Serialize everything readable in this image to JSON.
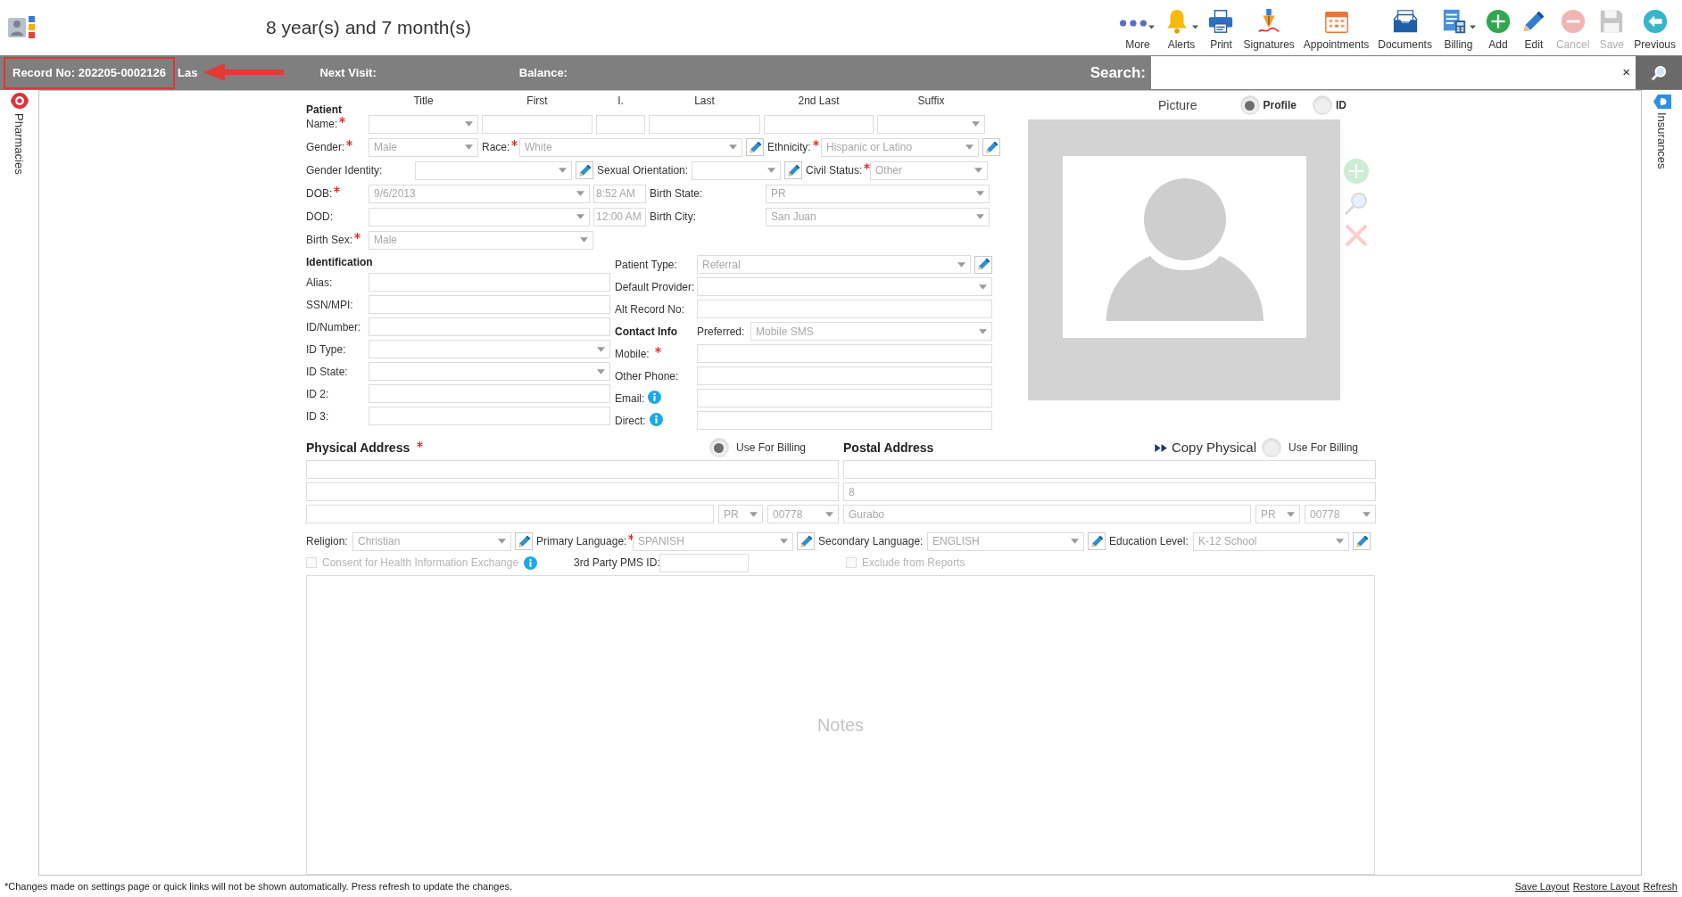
{
  "header": {
    "age": "8 year(s) and 7 month(s)"
  },
  "toolbar": [
    {
      "kind": "more",
      "label": "More",
      "dropdown": true,
      "disabled": false
    },
    {
      "kind": "alerts",
      "label": "Alerts",
      "dropdown": true,
      "disabled": false
    },
    {
      "kind": "print",
      "label": "Print",
      "dropdown": false,
      "disabled": false
    },
    {
      "kind": "signatures",
      "label": "Signatures",
      "dropdown": false,
      "disabled": false
    },
    {
      "kind": "appointments",
      "label": "Appointments",
      "dropdown": false,
      "disabled": false
    },
    {
      "kind": "documents",
      "label": "Documents",
      "dropdown": false,
      "disabled": false
    },
    {
      "kind": "billing",
      "label": "Billing",
      "dropdown": true,
      "disabled": false
    },
    {
      "kind": "add",
      "label": "Add",
      "dropdown": false,
      "disabled": false
    },
    {
      "kind": "edit",
      "label": "Edit",
      "dropdown": false,
      "disabled": false
    },
    {
      "kind": "cancel",
      "label": "Cancel",
      "dropdown": false,
      "disabled": true
    },
    {
      "kind": "save",
      "label": "Save",
      "dropdown": false,
      "disabled": true
    },
    {
      "kind": "previous",
      "label": "Previous",
      "dropdown": false,
      "disabled": false
    }
  ],
  "info_bar": {
    "record_no": "Record No: 202205-0002126",
    "cut_label": "Las",
    "next_visit": "Next Visit:",
    "balance": "Balance:"
  },
  "search": {
    "label": "Search:",
    "clear": "×"
  },
  "side_tabs": {
    "left": "Pharmacies",
    "right": "Insurances"
  },
  "patient": {
    "heading": "Patient",
    "columns": [
      "Title",
      "First",
      "I.",
      "Last",
      "2nd Last",
      "Suffix"
    ],
    "name": {
      "label": "Name:",
      "required": true
    },
    "gender": {
      "label": "Gender:",
      "required": true,
      "value": "Male"
    },
    "race": {
      "label": "Race:",
      "required": true,
      "value": "White",
      "editable": true
    },
    "ethnicity": {
      "label": "Ethnicity:",
      "required": true,
      "value": "Hispanic or Latino",
      "editable": true
    },
    "gender_identity": {
      "label": "Gender Identity:",
      "editable": true
    },
    "sexual_orientation": {
      "label": "Sexual Orientation:",
      "editable": true
    },
    "civil_status": {
      "label": "Civil Status:",
      "required": true,
      "value": "Other"
    },
    "dob": {
      "label": "DOB:",
      "required": true,
      "value": "9/6/2013",
      "time": "8:52 AM"
    },
    "birth_state": {
      "label": "Birth State:",
      "value": "PR"
    },
    "dod": {
      "label": "DOD:",
      "time": "12:00 AM"
    },
    "birth_city": {
      "label": "Birth City:",
      "value": "San Juan"
    },
    "birth_sex": {
      "label": "Birth Sex:",
      "required": true,
      "value": "Male"
    }
  },
  "identification": {
    "heading": "Identification",
    "fields": [
      {
        "label": "Alias:",
        "kind": "text"
      },
      {
        "label": "SSN/MPI:",
        "kind": "text"
      },
      {
        "label": "ID/Number:",
        "kind": "text"
      },
      {
        "label": "ID Type:",
        "kind": "select"
      },
      {
        "label": "ID State:",
        "kind": "select"
      },
      {
        "label": "ID 2:",
        "kind": "text"
      },
      {
        "label": "ID 3:",
        "kind": "text"
      }
    ]
  },
  "details": [
    {
      "label": "Patient Type:",
      "kind": "select",
      "value": "Referral",
      "editable": true
    },
    {
      "label": "Default Provider:",
      "kind": "select"
    },
    {
      "label": "Alt Record No:",
      "kind": "text"
    }
  ],
  "contact": {
    "heading": "Contact Info",
    "preferred": {
      "label": "Preferred:",
      "value": "Mobile SMS"
    },
    "fields": [
      {
        "label": "Mobile:",
        "required": true,
        "info": false
      },
      {
        "label": "Other Phone:",
        "info": false
      },
      {
        "label": "Email:",
        "info": true
      },
      {
        "label": "Direct:",
        "info": true
      }
    ]
  },
  "picture": {
    "title": "Picture",
    "options": [
      {
        "label": "Profile",
        "selected": true
      },
      {
        "label": "ID",
        "selected": false
      }
    ],
    "actions": [
      {
        "kind": "add",
        "disabled": true
      },
      {
        "kind": "zoom",
        "disabled": true
      },
      {
        "kind": "delete",
        "disabled": true
      }
    ]
  },
  "physical_address": {
    "heading": "Physical Address",
    "required": true,
    "use_for_billing": {
      "label": "Use For Billing",
      "selected": true
    },
    "state": "PR",
    "zip": "00778"
  },
  "postal_address": {
    "heading": "Postal Address",
    "copy": "Copy Physical",
    "use_for_billing": {
      "label": "Use For Billing",
      "selected": false
    },
    "line_2": "8",
    "city": "Gurabo",
    "state": "PR",
    "zip": "00778"
  },
  "preferences": [
    {
      "label": "Religion:",
      "value": "Christian",
      "editable": true
    },
    {
      "label": "Primary Language:",
      "required": true,
      "value": "SPANISH",
      "editable": true
    },
    {
      "label": "Secondary Language:",
      "value": "ENGLISH",
      "editable": true
    },
    {
      "label": "Education Level:",
      "value": "K-12 School",
      "editable": true
    }
  ],
  "consent": {
    "label": "Consent for Health Information Exchange",
    "checked": false,
    "disabled": true
  },
  "pms_id": {
    "label": "3rd Party PMS ID:"
  },
  "exclude": {
    "label": "Exclude from Reports",
    "checked": false,
    "disabled": true
  },
  "notes": {
    "placeholder": "Notes"
  },
  "footer": {
    "note": "*Changes made on settings page or quick links will not be shown automatically. Press refresh to update the changes.",
    "links": [
      "Save Layout",
      "Restore Layout",
      "Refresh"
    ]
  }
}
